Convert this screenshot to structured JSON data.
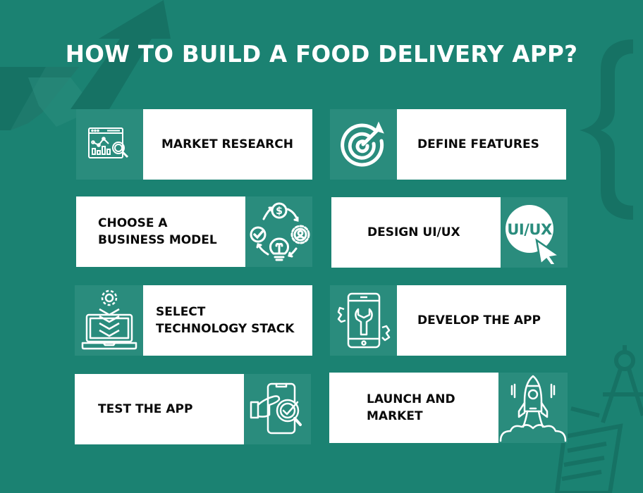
{
  "title": "HOW TO BUILD A FOOD DELIVERY APP?",
  "colors": {
    "background": "#1b8272",
    "background_shape": "#167264",
    "icon_panel": "#2a8c7d",
    "card": "#ffffff",
    "title_text": "#ffffff",
    "label_text": "#0a0a0a"
  },
  "steps": [
    {
      "label": "MARKET RESEARCH",
      "icon": "market-research-icon",
      "icon_side": "left"
    },
    {
      "label": "DEFINE FEATURES",
      "icon": "target-icon",
      "icon_side": "left"
    },
    {
      "label": "CHOOSE A\nBUSINESS MODEL",
      "icon": "business-model-cycle-icon",
      "icon_side": "right"
    },
    {
      "label": "DESIGN UI/UX",
      "icon": "ui-ux-cursor-icon",
      "icon_side": "right",
      "icon_text": "UI/UX"
    },
    {
      "label": "SELECT\nTECHNOLOGY STACK",
      "icon": "laptop-gear-stack-icon",
      "icon_side": "left"
    },
    {
      "label": "DEVELOP THE APP",
      "icon": "phone-wrench-icon",
      "icon_side": "left"
    },
    {
      "label": "TEST THE APP",
      "icon": "phone-test-check-icon",
      "icon_side": "right"
    },
    {
      "label": "LAUNCH AND\nMARKET",
      "icon": "rocket-launch-icon",
      "icon_side": "right"
    }
  ]
}
